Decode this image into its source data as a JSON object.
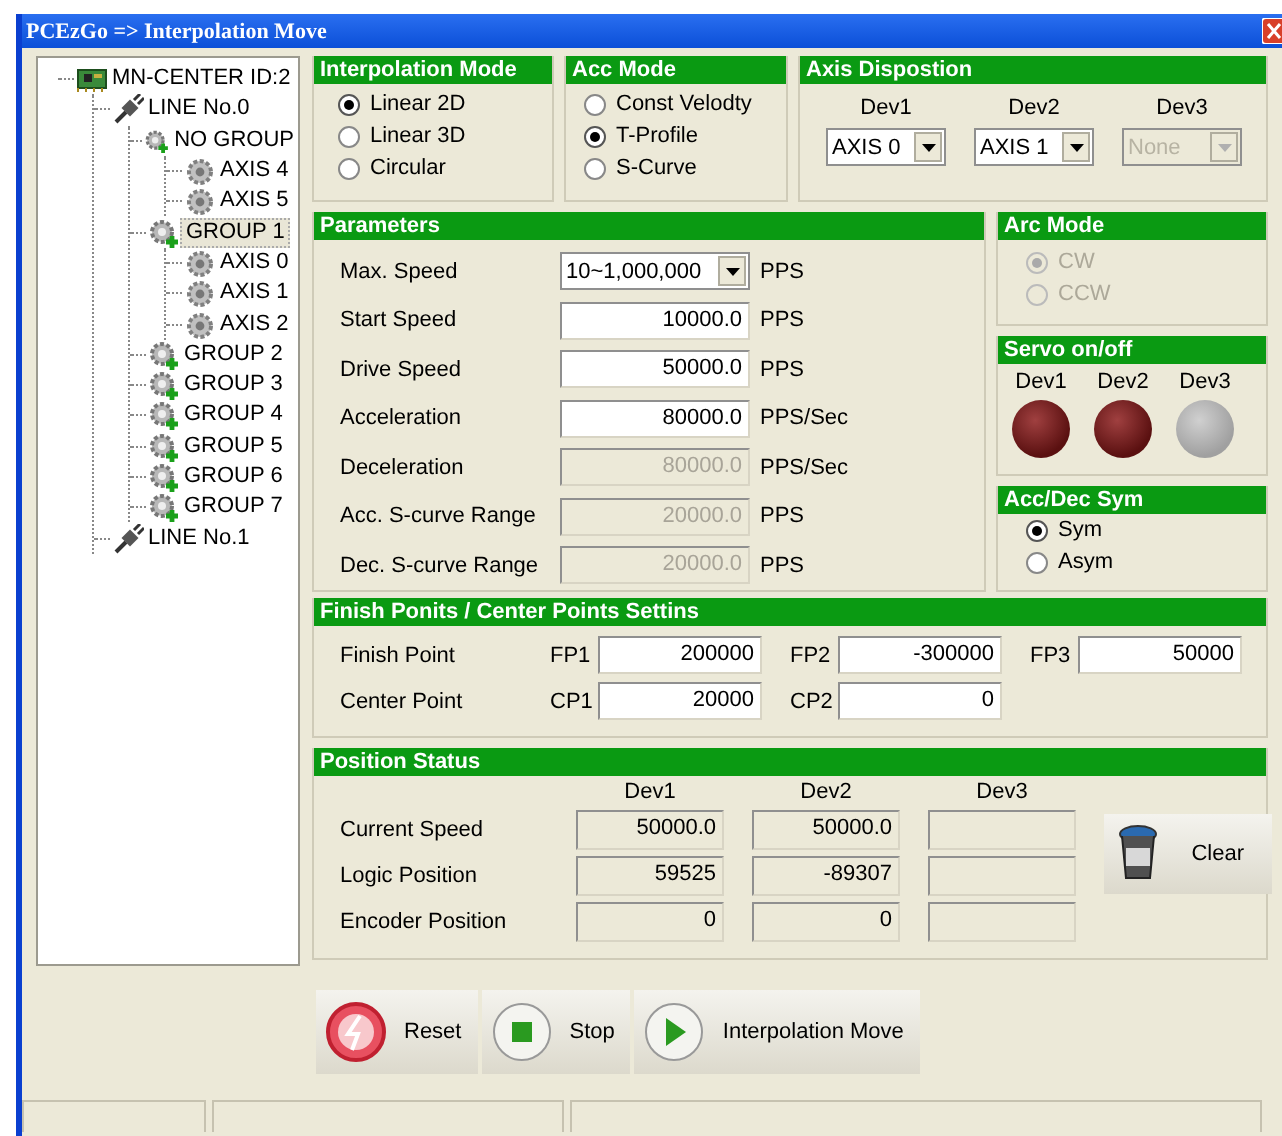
{
  "window": {
    "title": "PCEzGo => Interpolation Move"
  },
  "tree": {
    "items": [
      {
        "label": "MN-CENTER ID:2",
        "kind": "card",
        "selected": false,
        "children": [
          {
            "label": "LINE No.0",
            "kind": "line",
            "selected": false,
            "children": [
              {
                "label": "NO GROUP",
                "kind": "group",
                "selected": false,
                "children": [
                  {
                    "label": "AXIS 4",
                    "kind": "axis",
                    "selected": false
                  },
                  {
                    "label": "AXIS 5",
                    "kind": "axis",
                    "selected": false
                  }
                ]
              },
              {
                "label": "GROUP 1",
                "kind": "group",
                "selected": true,
                "children": [
                  {
                    "label": "AXIS 0",
                    "kind": "axis",
                    "selected": false
                  },
                  {
                    "label": "AXIS 1",
                    "kind": "axis",
                    "selected": false
                  },
                  {
                    "label": "AXIS 2",
                    "kind": "axis",
                    "selected": false
                  }
                ]
              },
              {
                "label": "GROUP 2",
                "kind": "group",
                "selected": false
              },
              {
                "label": "GROUP 3",
                "kind": "group",
                "selected": false
              },
              {
                "label": "GROUP 4",
                "kind": "group",
                "selected": false
              },
              {
                "label": "GROUP 5",
                "kind": "group",
                "selected": false
              },
              {
                "label": "GROUP 6",
                "kind": "group",
                "selected": false
              },
              {
                "label": "GROUP 7",
                "kind": "group",
                "selected": false
              }
            ]
          },
          {
            "label": "LINE No.1",
            "kind": "line",
            "selected": false
          }
        ]
      }
    ]
  },
  "interpolation_mode": {
    "title": "Interpolation Mode",
    "options": [
      {
        "label": "Linear 2D",
        "selected": true
      },
      {
        "label": "Linear 3D",
        "selected": false
      },
      {
        "label": "Circular",
        "selected": false
      }
    ]
  },
  "acc_mode": {
    "title": "Acc Mode",
    "options": [
      {
        "label": "Const Velodty",
        "selected": false
      },
      {
        "label": "T-Profile",
        "selected": true
      },
      {
        "label": "S-Curve",
        "selected": false
      }
    ]
  },
  "axis_disposition": {
    "title": "Axis Dispostion",
    "devices": [
      {
        "label": "Dev1",
        "value": "AXIS 0",
        "disabled": false
      },
      {
        "label": "Dev2",
        "value": "AXIS 1",
        "disabled": false
      },
      {
        "label": "Dev3",
        "value": "None",
        "disabled": true
      }
    ]
  },
  "parameters": {
    "title": "Parameters",
    "rows": [
      {
        "label": "Max. Speed",
        "kind": "dropdown",
        "value": "10~1,000,000",
        "unit": "PPS",
        "disabled": false
      },
      {
        "label": "Start Speed",
        "kind": "field",
        "value": "10000.0",
        "unit": "PPS",
        "disabled": false
      },
      {
        "label": "Drive Speed",
        "kind": "field",
        "value": "50000.0",
        "unit": "PPS",
        "disabled": false
      },
      {
        "label": "Acceleration",
        "kind": "field",
        "value": "80000.0",
        "unit": "PPS/Sec",
        "disabled": false
      },
      {
        "label": "Deceleration",
        "kind": "field",
        "value": "80000.0",
        "unit": "PPS/Sec",
        "disabled": true
      },
      {
        "label": "Acc. S-curve Range",
        "kind": "field",
        "value": "20000.0",
        "unit": "PPS",
        "disabled": true
      },
      {
        "label": "Dec. S-curve Range",
        "kind": "field",
        "value": "20000.0",
        "unit": "PPS",
        "disabled": true
      }
    ]
  },
  "arc_mode": {
    "title": "Arc Mode",
    "disabled": true,
    "options": [
      {
        "label": "CW",
        "selected": true
      },
      {
        "label": "CCW",
        "selected": false
      }
    ]
  },
  "servo": {
    "title": "Servo on/off",
    "devices": [
      {
        "label": "Dev1",
        "on": true
      },
      {
        "label": "Dev2",
        "on": true
      },
      {
        "label": "Dev3",
        "on": false
      }
    ]
  },
  "acc_dec_sym": {
    "title": "Acc/Dec Sym",
    "options": [
      {
        "label": "Sym",
        "selected": true
      },
      {
        "label": "Asym",
        "selected": false
      }
    ]
  },
  "points": {
    "title": "Finish Ponits / Center Points Settins",
    "rows": [
      {
        "label": "Finish Point",
        "fields": [
          {
            "label": "FP1",
            "value": "200000"
          },
          {
            "label": "FP2",
            "value": "-300000"
          },
          {
            "label": "FP3",
            "value": "50000"
          }
        ]
      },
      {
        "label": "Center Point",
        "fields": [
          {
            "label": "CP1",
            "value": "20000"
          },
          {
            "label": "CP2",
            "value": "0"
          }
        ]
      }
    ]
  },
  "position_status": {
    "title": "Position Status",
    "columns": [
      "Dev1",
      "Dev2",
      "Dev3"
    ],
    "rows": [
      {
        "label": "Current Speed",
        "values": [
          "50000.0",
          "50000.0"
        ]
      },
      {
        "label": "Logic Position",
        "values": [
          "59525",
          "-89307"
        ]
      },
      {
        "label": "Encoder Position",
        "values": [
          "0",
          "0"
        ]
      }
    ],
    "clear_button": "Clear"
  },
  "buttons": [
    {
      "label": "Reset",
      "kind": "reset"
    },
    {
      "label": "Stop",
      "kind": "stop"
    },
    {
      "label": "Interpolation Move",
      "kind": "play"
    }
  ]
}
